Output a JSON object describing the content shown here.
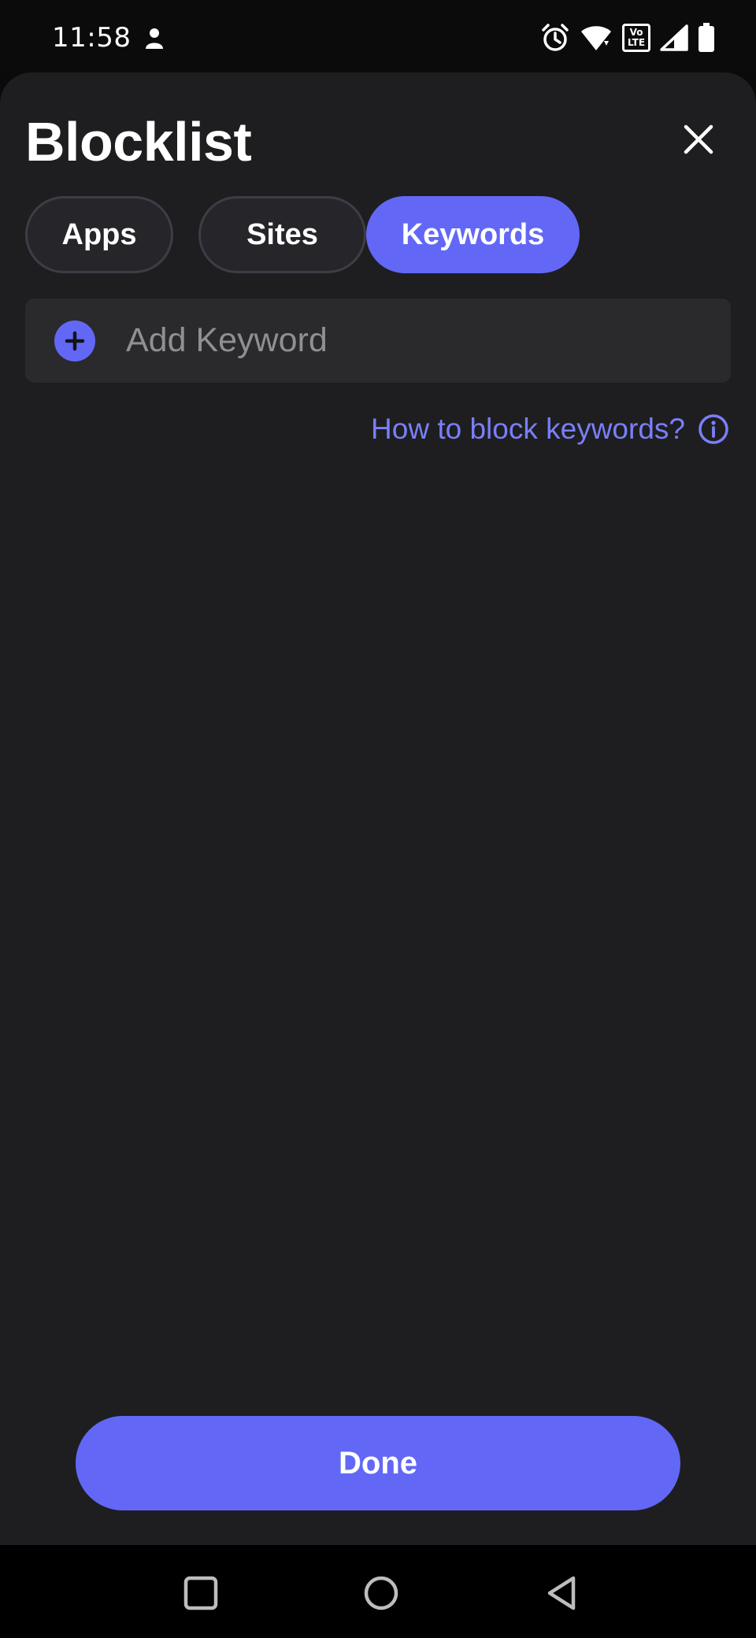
{
  "status_bar": {
    "time": "11:58",
    "icons": [
      "profile-icon",
      "alarm-icon",
      "wifi-icon",
      "volte-icon",
      "signal-icon",
      "battery-icon"
    ],
    "volte_top": "Vo",
    "volte_bottom": "LTE"
  },
  "header": {
    "title": "Blocklist",
    "close_icon": "close-icon"
  },
  "tabs": [
    {
      "label": "Apps",
      "selected": false
    },
    {
      "label": "Sites",
      "selected": false
    },
    {
      "label": "Keywords",
      "selected": true
    }
  ],
  "add_keyword": {
    "placeholder": "Add Keyword",
    "value": "",
    "icon": "plus-circle-icon"
  },
  "help_link": {
    "label": "How to block keywords?",
    "icon": "info-icon"
  },
  "done_button": {
    "label": "Done"
  },
  "nav_bar": {
    "icons": [
      "recents-icon",
      "home-icon",
      "back-icon"
    ]
  },
  "colors": {
    "accent": "#6268f5",
    "link": "#7a7ff8",
    "sheet_background": "#1e1e20",
    "field_background": "#2a2a2d",
    "tab_background": "#26262a"
  }
}
